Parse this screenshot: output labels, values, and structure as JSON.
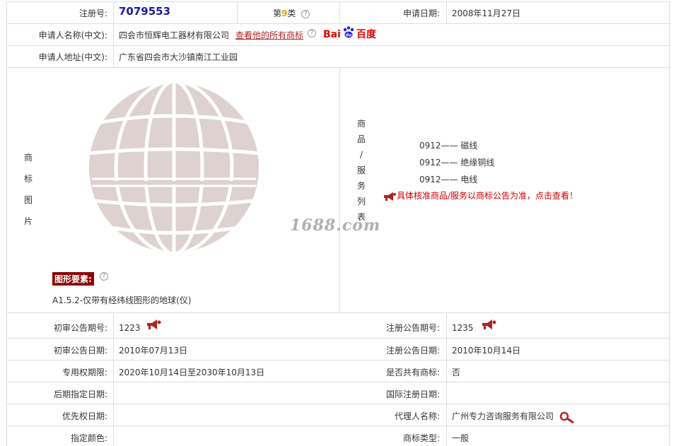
{
  "header": {
    "reg_no_label": "注册号:",
    "reg_no_value": "7079553",
    "class_prefix": "第",
    "class_number": "9",
    "class_suffix": "类",
    "apply_date_label": "申请日期:",
    "apply_date_value": "2008年11月27日"
  },
  "applicant": {
    "name_label": "申请人名称(中文):",
    "name_value": "四会市恒辉电工器材有限公司",
    "all_marks_link": "查看他的所有商标",
    "baidu_text1": "Bai",
    "baidu_text2": "百度",
    "address_label": "申请人地址(中文):",
    "address_value": "广东省四会市大沙镇南江工业园"
  },
  "image_section": {
    "label_chars": [
      "商",
      "标",
      "图",
      "片"
    ],
    "element_badge": "图形要素:",
    "element_desc": "A1.5.2-仅带有经纬线图形的地球(仪)",
    "watermark": "1688.com"
  },
  "goods_section": {
    "label_chars": [
      "商",
      "品",
      "/",
      "服",
      "务",
      "列",
      "表"
    ],
    "items": [
      {
        "code": "0912——",
        "name": "磁线"
      },
      {
        "code": "0912——",
        "name": "绝缘铜线"
      },
      {
        "code": "0912——",
        "name": "电线"
      }
    ],
    "notice": "具体核准商品/服务以商标公告为准，点击查看！"
  },
  "details": {
    "prelim_no_label": "初审公告期号:",
    "prelim_no_value": "1223",
    "reg_no2_label": "注册公告期号:",
    "reg_no2_value": "1235",
    "prelim_date_label": "初审公告日期:",
    "prelim_date_value": "2010年07月13日",
    "reg_date_label": "注册公告日期:",
    "reg_date_value": "2010年10月14日",
    "exclusive_label": "专用权期限:",
    "exclusive_value": "2020年10月14日至2030年10月13日",
    "shared_label": "是否共有商标:",
    "shared_value": "否",
    "later_label": "后期指定日期:",
    "later_value": "",
    "intl_label": "国际注册日期:",
    "intl_value": "",
    "priority_label": "优先权日期:",
    "priority_value": "",
    "agent_label": "代理人名称:",
    "agent_value": "广州专力咨询服务有限公司",
    "color_label": "指定颜色:",
    "color_value": "",
    "type_label": "商标类型:",
    "type_value": "一般"
  },
  "colors": {
    "reg_no": "#1a1aa6",
    "class_number": "#e8a000",
    "link": "#b22222",
    "badge_bg": "#8b0000",
    "notice": "#cc0000",
    "globe": "#ddd2d0"
  }
}
